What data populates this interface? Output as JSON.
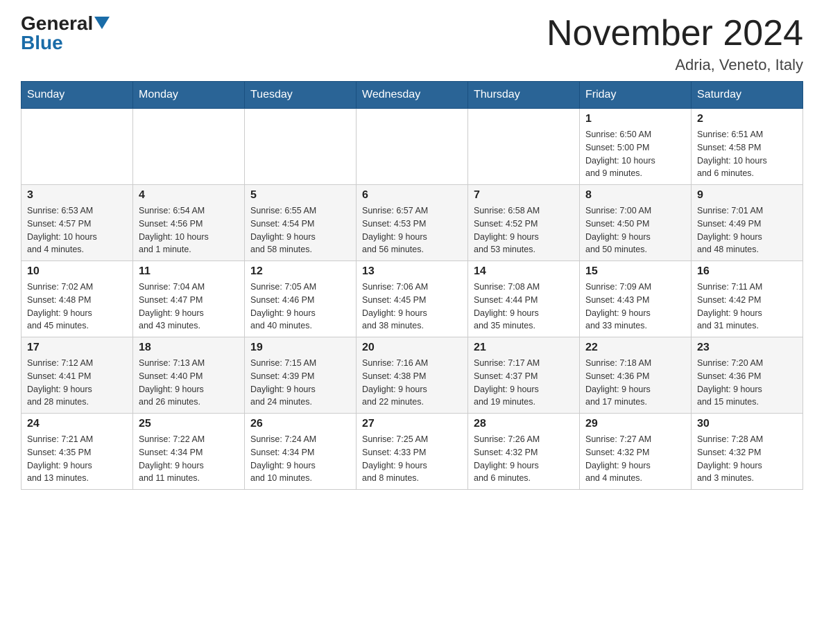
{
  "header": {
    "logo_general": "General",
    "logo_blue": "Blue",
    "month_title": "November 2024",
    "location": "Adria, Veneto, Italy"
  },
  "weekdays": [
    "Sunday",
    "Monday",
    "Tuesday",
    "Wednesday",
    "Thursday",
    "Friday",
    "Saturday"
  ],
  "rows": [
    {
      "days": [
        {
          "number": "",
          "info": ""
        },
        {
          "number": "",
          "info": ""
        },
        {
          "number": "",
          "info": ""
        },
        {
          "number": "",
          "info": ""
        },
        {
          "number": "",
          "info": ""
        },
        {
          "number": "1",
          "info": "Sunrise: 6:50 AM\nSunset: 5:00 PM\nDaylight: 10 hours\nand 9 minutes."
        },
        {
          "number": "2",
          "info": "Sunrise: 6:51 AM\nSunset: 4:58 PM\nDaylight: 10 hours\nand 6 minutes."
        }
      ]
    },
    {
      "days": [
        {
          "number": "3",
          "info": "Sunrise: 6:53 AM\nSunset: 4:57 PM\nDaylight: 10 hours\nand 4 minutes."
        },
        {
          "number": "4",
          "info": "Sunrise: 6:54 AM\nSunset: 4:56 PM\nDaylight: 10 hours\nand 1 minute."
        },
        {
          "number": "5",
          "info": "Sunrise: 6:55 AM\nSunset: 4:54 PM\nDaylight: 9 hours\nand 58 minutes."
        },
        {
          "number": "6",
          "info": "Sunrise: 6:57 AM\nSunset: 4:53 PM\nDaylight: 9 hours\nand 56 minutes."
        },
        {
          "number": "7",
          "info": "Sunrise: 6:58 AM\nSunset: 4:52 PM\nDaylight: 9 hours\nand 53 minutes."
        },
        {
          "number": "8",
          "info": "Sunrise: 7:00 AM\nSunset: 4:50 PM\nDaylight: 9 hours\nand 50 minutes."
        },
        {
          "number": "9",
          "info": "Sunrise: 7:01 AM\nSunset: 4:49 PM\nDaylight: 9 hours\nand 48 minutes."
        }
      ]
    },
    {
      "days": [
        {
          "number": "10",
          "info": "Sunrise: 7:02 AM\nSunset: 4:48 PM\nDaylight: 9 hours\nand 45 minutes."
        },
        {
          "number": "11",
          "info": "Sunrise: 7:04 AM\nSunset: 4:47 PM\nDaylight: 9 hours\nand 43 minutes."
        },
        {
          "number": "12",
          "info": "Sunrise: 7:05 AM\nSunset: 4:46 PM\nDaylight: 9 hours\nand 40 minutes."
        },
        {
          "number": "13",
          "info": "Sunrise: 7:06 AM\nSunset: 4:45 PM\nDaylight: 9 hours\nand 38 minutes."
        },
        {
          "number": "14",
          "info": "Sunrise: 7:08 AM\nSunset: 4:44 PM\nDaylight: 9 hours\nand 35 minutes."
        },
        {
          "number": "15",
          "info": "Sunrise: 7:09 AM\nSunset: 4:43 PM\nDaylight: 9 hours\nand 33 minutes."
        },
        {
          "number": "16",
          "info": "Sunrise: 7:11 AM\nSunset: 4:42 PM\nDaylight: 9 hours\nand 31 minutes."
        }
      ]
    },
    {
      "days": [
        {
          "number": "17",
          "info": "Sunrise: 7:12 AM\nSunset: 4:41 PM\nDaylight: 9 hours\nand 28 minutes."
        },
        {
          "number": "18",
          "info": "Sunrise: 7:13 AM\nSunset: 4:40 PM\nDaylight: 9 hours\nand 26 minutes."
        },
        {
          "number": "19",
          "info": "Sunrise: 7:15 AM\nSunset: 4:39 PM\nDaylight: 9 hours\nand 24 minutes."
        },
        {
          "number": "20",
          "info": "Sunrise: 7:16 AM\nSunset: 4:38 PM\nDaylight: 9 hours\nand 22 minutes."
        },
        {
          "number": "21",
          "info": "Sunrise: 7:17 AM\nSunset: 4:37 PM\nDaylight: 9 hours\nand 19 minutes."
        },
        {
          "number": "22",
          "info": "Sunrise: 7:18 AM\nSunset: 4:36 PM\nDaylight: 9 hours\nand 17 minutes."
        },
        {
          "number": "23",
          "info": "Sunrise: 7:20 AM\nSunset: 4:36 PM\nDaylight: 9 hours\nand 15 minutes."
        }
      ]
    },
    {
      "days": [
        {
          "number": "24",
          "info": "Sunrise: 7:21 AM\nSunset: 4:35 PM\nDaylight: 9 hours\nand 13 minutes."
        },
        {
          "number": "25",
          "info": "Sunrise: 7:22 AM\nSunset: 4:34 PM\nDaylight: 9 hours\nand 11 minutes."
        },
        {
          "number": "26",
          "info": "Sunrise: 7:24 AM\nSunset: 4:34 PM\nDaylight: 9 hours\nand 10 minutes."
        },
        {
          "number": "27",
          "info": "Sunrise: 7:25 AM\nSunset: 4:33 PM\nDaylight: 9 hours\nand 8 minutes."
        },
        {
          "number": "28",
          "info": "Sunrise: 7:26 AM\nSunset: 4:32 PM\nDaylight: 9 hours\nand 6 minutes."
        },
        {
          "number": "29",
          "info": "Sunrise: 7:27 AM\nSunset: 4:32 PM\nDaylight: 9 hours\nand 4 minutes."
        },
        {
          "number": "30",
          "info": "Sunrise: 7:28 AM\nSunset: 4:32 PM\nDaylight: 9 hours\nand 3 minutes."
        }
      ]
    }
  ]
}
